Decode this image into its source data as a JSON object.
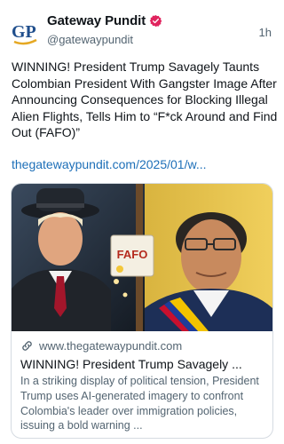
{
  "author": {
    "name": "Gateway Pundit",
    "handle": "@gatewaypundit",
    "avatar_text": "GP",
    "verified": true
  },
  "post": {
    "timestamp": "1h",
    "text": "WINNING! President Trump Savagely Taunts Colombian President With Gangster Image After Announcing Consequences for Blocking Illegal Alien Flights, Tells Him to “F*ck Around and Find Out (FAFO)”",
    "link_text": "thegatewaypundit.com/2025/01/w..."
  },
  "card": {
    "image_sign_text": "FAFO",
    "domain": "www.thegatewaypundit.com",
    "title": "WINNING! President Trump Savagely ...",
    "description": "In a striking display of political tension, President Trump uses AI-generated imagery to confront Colombia's leader over immigration policies, issuing a bold warning ..."
  },
  "colors": {
    "verified_badge": "#e0245e",
    "link": "#1d6fb8",
    "avatar_blue": "#1f4e8c",
    "avatar_gold": "#e5a823"
  },
  "icons": [
    "verified-badge-icon",
    "link-icon"
  ]
}
